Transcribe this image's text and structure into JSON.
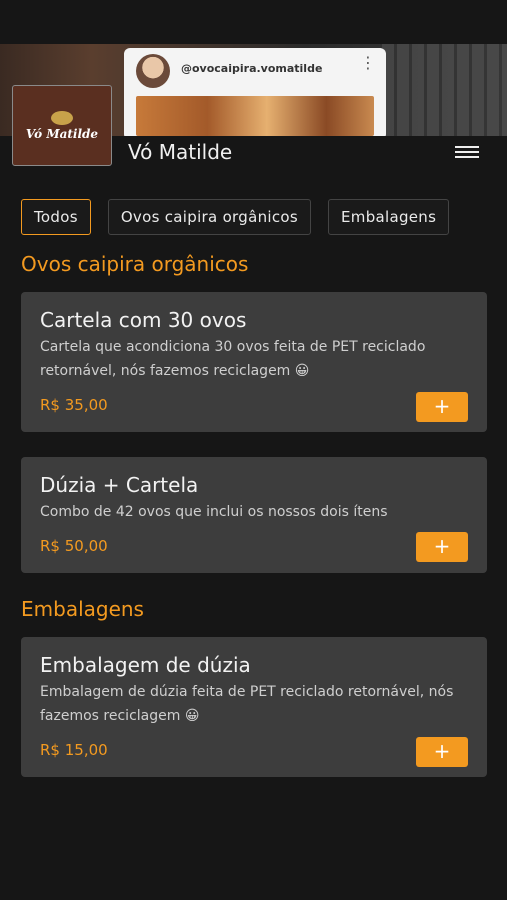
{
  "banner": {
    "instagram_handle": "@ovocaipira.vomatilde",
    "menu_dots": "⋮"
  },
  "logo": {
    "text": "Vó Matilde"
  },
  "header": {
    "store_name": "Vó Matilde"
  },
  "categories": [
    {
      "label": "Todos",
      "active": true
    },
    {
      "label": "Ovos caipira orgânicos",
      "active": false
    },
    {
      "label": "Embalagens",
      "active": false
    }
  ],
  "sections": [
    {
      "title": "Ovos caipira orgânicos",
      "products": [
        {
          "name": "Cartela com 30 ovos",
          "description": "Cartela que acondiciona 30 ovos feita de PET reciclado retornável, nós fazemos reciclagem 😀",
          "price": "R$ 35,00",
          "add_label": "+"
        },
        {
          "name": "Dúzia + Cartela",
          "description": "Combo de 42 ovos que inclui os nossos dois ítens",
          "price": "R$ 50,00",
          "add_label": "+"
        }
      ]
    },
    {
      "title": "Embalagens",
      "products": [
        {
          "name": "Embalagem de dúzia",
          "description": "Embalagem de dúzia feita de PET reciclado retornável, nós fazemos reciclagem 😀",
          "price": "R$ 15,00",
          "add_label": "+"
        }
      ]
    }
  ],
  "colors": {
    "accent": "#f39a20",
    "card": "#3d3d3d",
    "background": "#161616"
  }
}
